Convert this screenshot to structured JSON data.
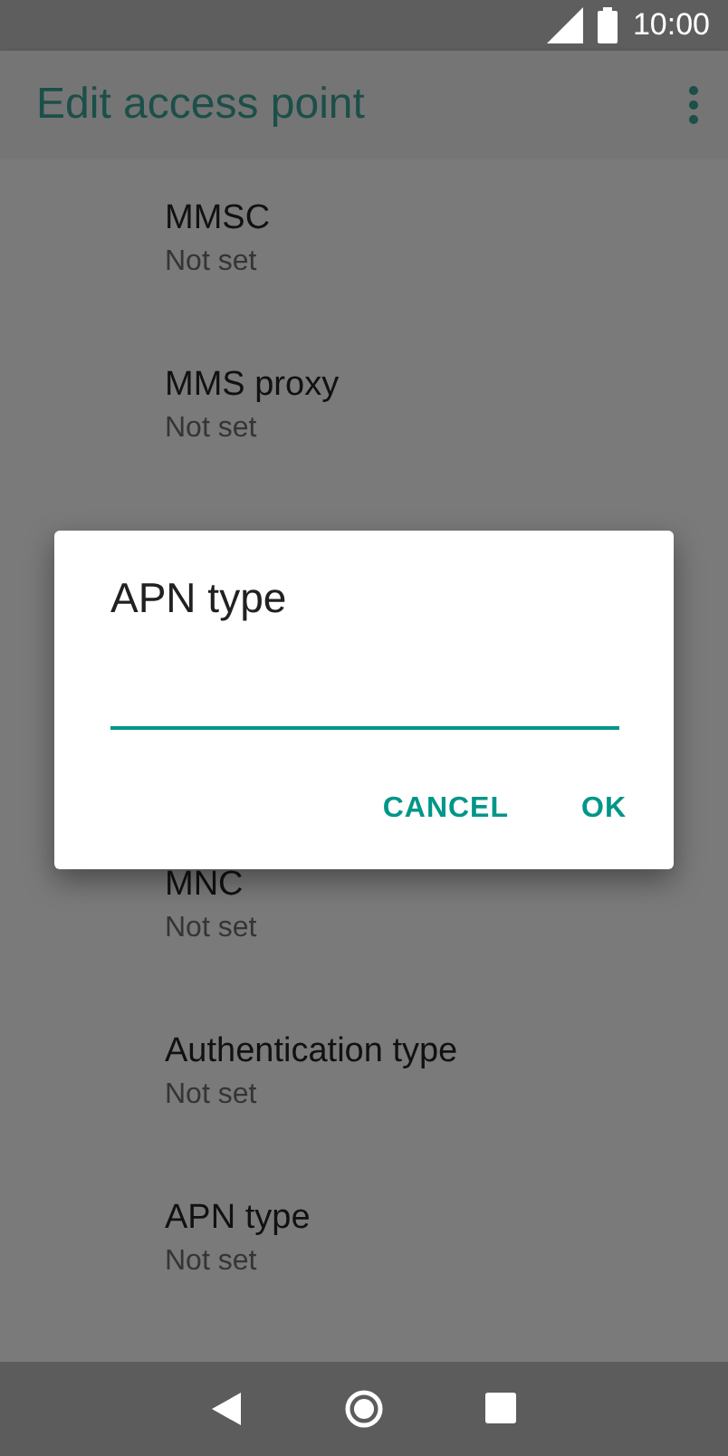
{
  "status_bar": {
    "time": "10:00"
  },
  "app_bar": {
    "title": "Edit access point"
  },
  "items_above_dialog": [
    {
      "title": "MMSC",
      "summary": "Not set"
    },
    {
      "title": "MMS proxy",
      "summary": "Not set"
    }
  ],
  "items_below_dialog": [
    {
      "title": "MNC",
      "summary": "Not set"
    },
    {
      "title": "Authentication type",
      "summary": "Not set"
    },
    {
      "title": "APN type",
      "summary": "Not set"
    }
  ],
  "dialog": {
    "title": "APN type",
    "buttons": [
      "CANCEL",
      "OK"
    ]
  }
}
